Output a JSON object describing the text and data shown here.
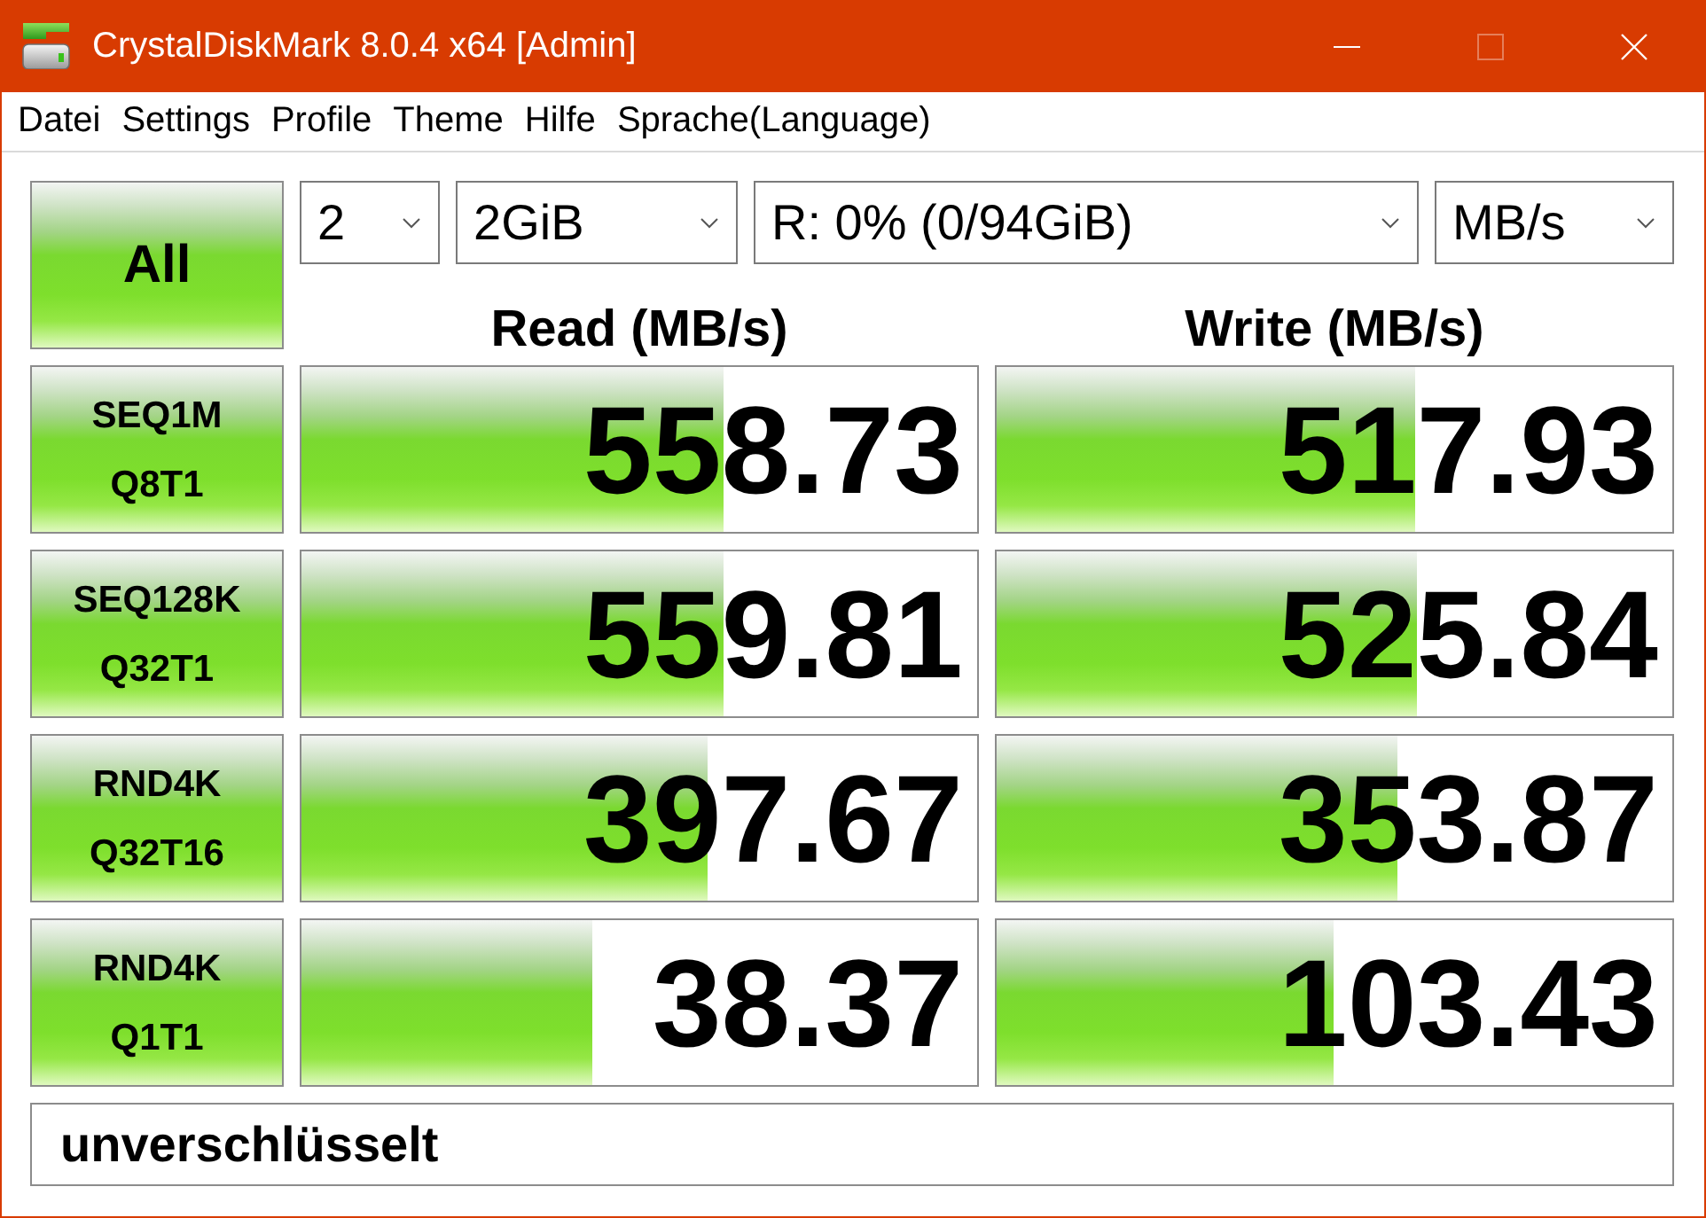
{
  "window": {
    "title": "CrystalDiskMark 8.0.4 x64 [Admin]",
    "controls": [
      {
        "kind": "minimize",
        "disabled": false
      },
      {
        "kind": "maximize",
        "disabled": true
      },
      {
        "kind": "close",
        "disabled": false
      }
    ]
  },
  "menu": [
    "Datei",
    "Settings",
    "Profile",
    "Theme",
    "Hilfe",
    "Sprache(Language)"
  ],
  "all_button": {
    "label": "All"
  },
  "settings": [
    {
      "value": "2"
    },
    {
      "value": "2GiB"
    },
    {
      "value": "R: 0% (0/94GiB)"
    },
    {
      "value": "MB/s"
    }
  ],
  "columns": [
    "Read (MB/s)",
    "Write (MB/s)"
  ],
  "tests": [
    {
      "label": [
        "SEQ1M",
        "Q8T1"
      ],
      "read": {
        "value": "558.73",
        "level": 0.625
      },
      "write": {
        "value": "517.93",
        "level": 0.619
      }
    },
    {
      "label": [
        "SEQ128K",
        "Q32T1"
      ],
      "read": {
        "value": "559.81",
        "level": 0.625
      },
      "write": {
        "value": "525.84",
        "level": 0.622
      }
    },
    {
      "label": [
        "RND4K",
        "Q32T16"
      ],
      "read": {
        "value": "397.67",
        "level": 0.601
      },
      "write": {
        "value": "353.87",
        "level": 0.593
      }
    },
    {
      "label": [
        "RND4K",
        "Q1T1"
      ],
      "read": {
        "value": "38.37",
        "level": 0.43
      },
      "write": {
        "value": "103.43",
        "level": 0.499
      }
    }
  ],
  "comment": {
    "value": "unverschlüsselt"
  }
}
